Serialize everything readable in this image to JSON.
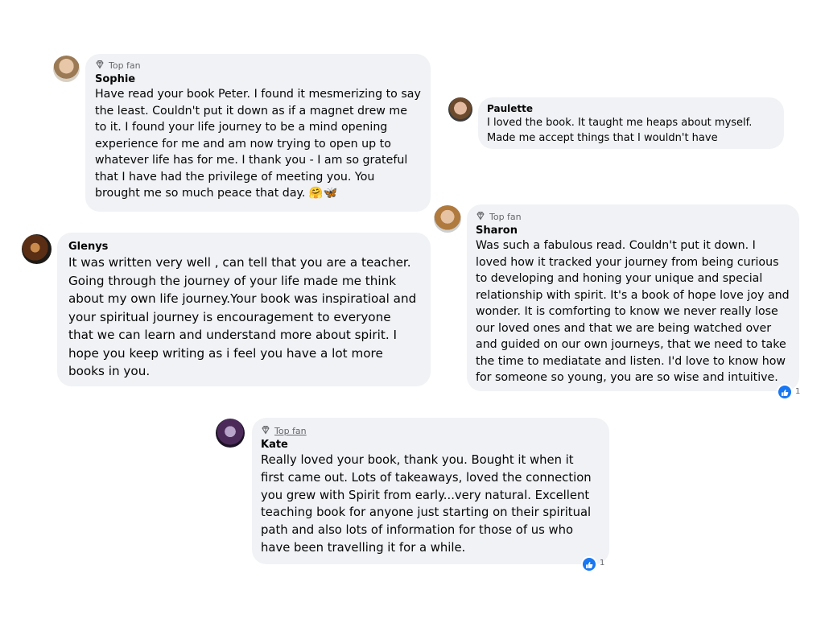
{
  "comments": [
    {
      "name": "Sophie",
      "badge": "Top fan",
      "text": "Have read your book Peter. I found it mesmerizing to say the least. Couldn't put it down as if a magnet drew me to it. I found your life journey to be a mind opening experience for me and am now trying to open up to whatever life has for me. I thank you - I am so grateful that I have had the privilege of meeting you. You brought me so much peace that day. 🤗🦋"
    },
    {
      "name": "Paulette",
      "text": "I loved the book. It taught me heaps about myself. Made me accept things that I wouldn't have"
    },
    {
      "name": "Glenys",
      "text": "It was written very well , can tell that you are a teacher. Going through the journey of your life made me think about my own life journey.Your book was inspiratioal and your spiritual journey is encouragement to everyone that we can learn and understand more about spirit. I hope you keep writing as i feel you have a lot more books in you."
    },
    {
      "name": "Sharon",
      "badge": "Top fan",
      "text": "Was such a fabulous read. Couldn't put it down. I loved how it tracked your journey from being curious to developing and honing your unique and special relationship with spirit. It's a book of hope love joy and wonder. It is comforting to know we never really lose our loved ones and that we are being watched over and guided on our own journeys, that we need to take the time to mediatate and listen. I'd love to know how for someone so young, you are so wise and intuitive.",
      "reaction_count": "1"
    },
    {
      "name": "Kate",
      "badge": "Top fan",
      "text": "Really loved your book, thank you. Bought it when it first came out. Lots of takeaways, loved the connection you grew with Spirit from early...very natural. Excellent teaching book for anyone just starting on their spiritual path and also lots of information for those of us who have been travelling it for a while.",
      "reaction_count": "1"
    }
  ],
  "colors": {
    "bubble_bg": "#f0f2f5",
    "badge_text": "#65676b",
    "like_blue": "#1877f2"
  },
  "icons": {
    "top_fan": "diamond-icon",
    "reaction": "like-icon"
  }
}
